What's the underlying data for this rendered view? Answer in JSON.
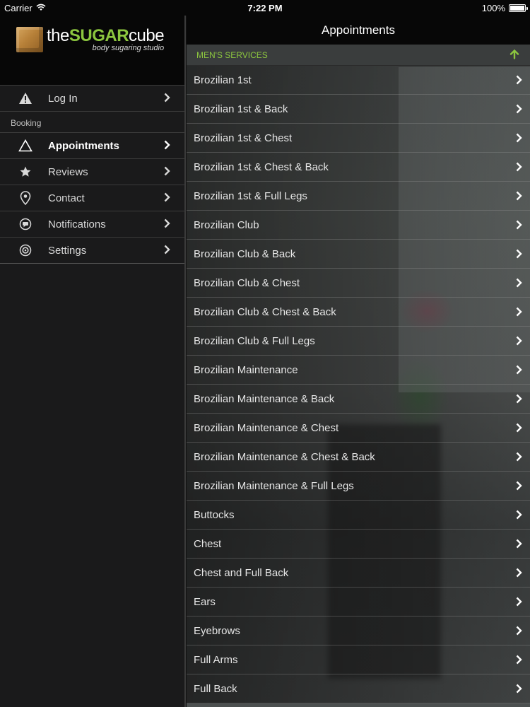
{
  "status_bar": {
    "carrier": "Carrier",
    "time": "7:22 PM",
    "battery": "100%",
    "battery_level": 1.0
  },
  "brand": {
    "word_the": "the",
    "word_sugar": "SUGAR",
    "word_cube": "cube",
    "tagline": "body sugaring studio"
  },
  "sidebar": {
    "top_item": {
      "label": "Log In",
      "icon": "warning-icon"
    },
    "section_label": "Booking",
    "items": [
      {
        "label": "Appointments",
        "icon": "triangle-icon",
        "active": true
      },
      {
        "label": "Reviews",
        "icon": "star-icon"
      },
      {
        "label": "Contact",
        "icon": "location-pin-icon"
      },
      {
        "label": "Notifications",
        "icon": "chat-bubble-icon"
      },
      {
        "label": "Settings",
        "icon": "gear-icon"
      }
    ]
  },
  "main": {
    "title": "Appointments",
    "section": {
      "title": "MEN'S SERVICES",
      "accent_color": "#8cc63f"
    },
    "services": [
      "Brozilian 1st",
      "Brozilian 1st & Back",
      "Brozilian 1st & Chest",
      "Brozilian 1st & Chest & Back",
      "Brozilian 1st & Full Legs",
      "Brozilian Club",
      "Brozilian Club & Back",
      "Brozilian Club & Chest",
      "Brozilian Club & Chest & Back",
      "Brozilian Club & Full Legs",
      "Brozilian Maintenance",
      "Brozilian Maintenance & Back",
      "Brozilian Maintenance & Chest",
      "Brozilian Maintenance & Chest & Back",
      "Brozilian Maintenance & Full Legs",
      "Buttocks",
      "Chest",
      "Chest and Full Back",
      "Ears",
      "Eyebrows",
      "Full Arms",
      "Full Back"
    ]
  }
}
